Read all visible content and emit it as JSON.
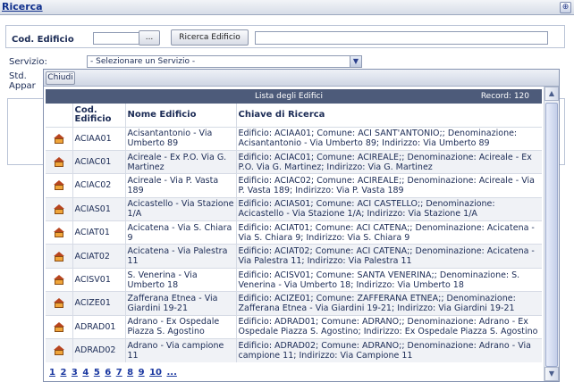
{
  "header": {
    "title": "Ricerca",
    "corner_icon": "app-icon"
  },
  "form": {
    "cod_label": "Cod. Edificio",
    "cod_value": "",
    "dots_label": "...",
    "search_button": "Ricerca Edificio",
    "key_value": "",
    "servizio_label": "Servizio:",
    "servizio_selected": "- Selezionare un Servizio -",
    "std_label": "Std.",
    "appar_label": "Appar"
  },
  "popup": {
    "close_label": "Chiudi",
    "list_title": "Lista degli Edifici",
    "record_count": "Record: 120",
    "columns": [
      "Cod. Edificio",
      "Nome Edificio",
      "Chiave di Ricerca"
    ],
    "rows": [
      {
        "code": "ACIAA01",
        "name": "Acisantantonio - Via Umberto 89",
        "key": "Edificio: ACIAA01; Comune: ACI SANT'ANTONIO;; Denominazione: Acisantantonio - Via Umberto 89; Indirizzo: Via Umberto 89"
      },
      {
        "code": "ACIAC01",
        "name": "Acireale - Ex P.O. Via G. Martinez",
        "key": "Edificio: ACIAC01; Comune: ACIREALE;; Denominazione: Acireale - Ex P.O. Via G. Martinez; Indirizzo: Via G. Martinez"
      },
      {
        "code": "ACIAC02",
        "name": "Acireale - Via P. Vasta 189",
        "key": "Edificio: ACIAC02; Comune: ACIREALE;; Denominazione: Acireale - Via P. Vasta 189; Indirizzo: Via P. Vasta 189"
      },
      {
        "code": "ACIAS01",
        "name": "Acicastello - Via Stazione 1/A",
        "key": "Edificio: ACIAS01; Comune: ACI CASTELLO;; Denominazione: Acicastello - Via Stazione 1/A; Indirizzo: Via Stazione 1/A"
      },
      {
        "code": "ACIAT01",
        "name": "Acicatena - Via S. Chiara 9",
        "key": "Edificio: ACIAT01; Comune: ACI CATENA;; Denominazione: Acicatena - Via S. Chiara 9; Indirizzo: Via S. Chiara 9"
      },
      {
        "code": "ACIAT02",
        "name": "Acicatena - Via Palestra 11",
        "key": "Edificio: ACIAT02; Comune: ACI CATENA;; Denominazione: Acicatena - Via Palestra 11; Indirizzo: Via Palestra 11"
      },
      {
        "code": "ACISV01",
        "name": "S. Venerina - Via Umberto 18",
        "key": "Edificio: ACISV01; Comune: SANTA VENERINA;; Denominazione: S. Venerina - Via Umberto 18; Indirizzo: Via Umberto 18"
      },
      {
        "code": "ACIZE01",
        "name": "Zafferana Etnea - Via Giardini 19-21",
        "key": "Edificio: ACIZE01; Comune: ZAFFERANA ETNEA;; Denominazione: Zafferana Etnea - Via Giardini 19-21; Indirizzo: Via Giardini 19-21"
      },
      {
        "code": "ADRAD01",
        "name": "Adrano - Ex Ospedale Piazza S. Agostino",
        "key": "Edificio: ADRAD01; Comune: ADRANO;; Denominazione: Adrano - Ex Ospedale Piazza S. Agostino; Indirizzo: Ex Ospedale Piazza S. Agostino"
      },
      {
        "code": "ADRAD02",
        "name": "Adrano - Via campione 11",
        "key": "Edificio: ADRAD02; Comune: ADRANO;; Denominazione: Adrano - Via campione 11; Indirizzo: Via Campione 11"
      }
    ],
    "row_icon": "building-icon",
    "pages": [
      "1",
      "2",
      "3",
      "4",
      "5",
      "6",
      "7",
      "8",
      "9",
      "10",
      "..."
    ]
  }
}
